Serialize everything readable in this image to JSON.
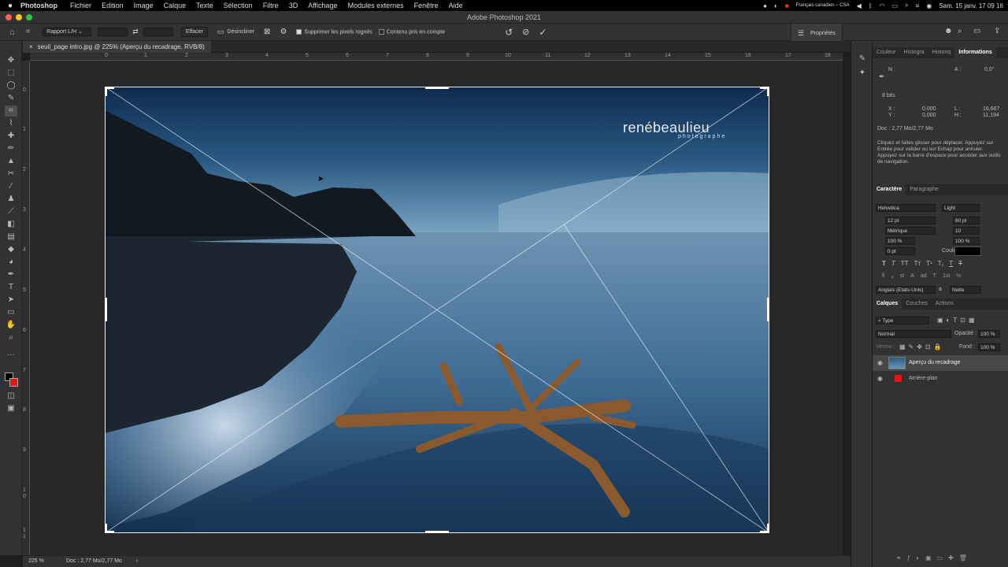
{
  "menubar": {
    "apple": "",
    "app": "Photoshop",
    "items": [
      "Fichier",
      "Edition",
      "Image",
      "Calque",
      "Texte",
      "Sélection",
      "Filtre",
      "3D",
      "Affichage",
      "Modules externes",
      "Fenêtre",
      "Aide"
    ],
    "keyboard": "Français canadien – CSA",
    "datetime": "Sam. 15 janv.  17 09 16"
  },
  "window": {
    "title": "Adobe Photoshop 2021"
  },
  "options": {
    "ratio": "Rapport L/H",
    "clear": "Effacer",
    "straighten": "Désincliner",
    "delete_pixels": "Supprimer les pixels rognés",
    "content_aware": "Contenu pris en compte",
    "properties": "Propriétés"
  },
  "document": {
    "tab": "seuil_page intro.jpg @ 225% (Aperçu du recadrage, RVB/8)",
    "watermark_name": "renébeaulieu",
    "watermark_sub": "photographe"
  },
  "rulers": {
    "h": [
      "0",
      "1",
      "2",
      "3",
      "4",
      "5",
      "6",
      "7",
      "8",
      "9",
      "10",
      "11",
      "12",
      "13",
      "14",
      "15",
      "16",
      "17",
      "18"
    ],
    "v": [
      "0",
      "1",
      "2",
      "3",
      "4",
      "5",
      "6",
      "7",
      "8",
      "9",
      "1",
      "0",
      "1",
      "1"
    ]
  },
  "status": {
    "zoom": "225 %",
    "doc": "Doc : 2,77 Mo/2,77 Mo"
  },
  "info_panel": {
    "tabs": [
      "Couleur",
      "Histogra",
      "Historiq",
      "Informations"
    ],
    "n_label": "N :",
    "a_label": "A :",
    "a_value": "0,0°",
    "bits": "8 bits",
    "x_label": "X :",
    "x_value": "0,000",
    "y_label": "Y :",
    "y_value": "0,000",
    "l_label": "L :",
    "l_value": "16,667",
    "h_label": "H :",
    "h_value": "11,194",
    "doc": "Doc : 2,77 Mo/2,77 Mo",
    "help": "Cliquez et faites glisser pour déplacer. Appuyez sur Entrée pour valider ou sur Echap pour annuler. Appuyez sur la barre d'espace pour accéder aux outils de navigation."
  },
  "char_panel": {
    "tabs": [
      "Caractère",
      "Paragraphe"
    ],
    "font": "Helvetica",
    "style": "Light",
    "size": "12 pt",
    "leading": "60 pt",
    "kerning": "Métrique",
    "tracking": "10",
    "vscale": "100 %",
    "hscale": "100 %",
    "baseline": "0 pt",
    "color_label": "Couleur :",
    "language": "Anglais (Etats-Unis)",
    "aa": "Nette",
    "aa_label": "a",
    "style_buttons": [
      "T",
      "T",
      "TT",
      "Tт",
      "T¹",
      "T₁",
      "T",
      "T"
    ],
    "ot_buttons": [
      "ﬁ",
      "ℴ",
      "st",
      "A",
      "ad",
      "T",
      "1st",
      "½"
    ]
  },
  "layers_panel": {
    "tabs": [
      "Calques",
      "Couches",
      "Actions"
    ],
    "filter": "Type",
    "blend": "Normal",
    "opacity_label": "Opacité :",
    "opacity": "100 %",
    "lock_label": "Verrou :",
    "fill_label": "Fond :",
    "fill": "100 %",
    "layers": [
      {
        "name": "Aperçu du recadrage"
      },
      {
        "name": "Arrière-plan"
      }
    ]
  },
  "colors": {
    "accent": "#1473e6",
    "fg": "#000000",
    "bg": "#e01818"
  }
}
